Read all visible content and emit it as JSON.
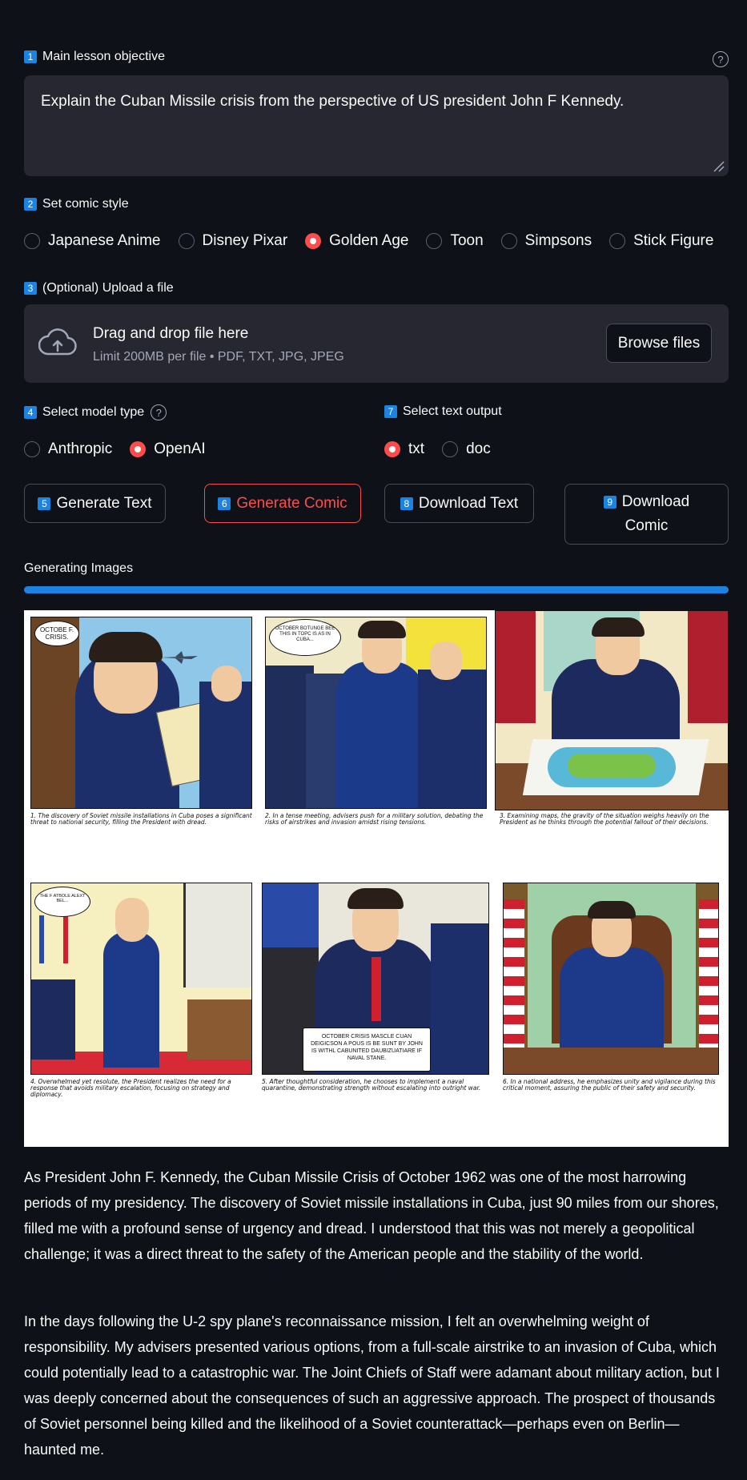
{
  "objective": {
    "badge": "1",
    "label": "Main lesson objective",
    "help_icon": "?",
    "value": "Explain the Cuban Missile crisis from the perspective of US president John F Kennedy."
  },
  "style": {
    "badge": "2",
    "label": "Set comic style",
    "options": [
      "Japanese Anime",
      "Disney Pixar",
      "Golden Age",
      "Toon",
      "Simpsons",
      "Stick Figure"
    ],
    "selected": "Golden Age"
  },
  "upload": {
    "badge": "3",
    "label": "(Optional) Upload a file",
    "drop_title": "Drag and drop file here",
    "drop_subtitle": "Limit 200MB per file • PDF, TXT, JPG, JPEG",
    "browse_label": "Browse files",
    "icon": "cloud-upload-icon"
  },
  "model": {
    "badge": "4",
    "label": "Select model type",
    "help_icon": "?",
    "options": [
      "Anthropic",
      "OpenAI"
    ],
    "selected": "OpenAI"
  },
  "text_output": {
    "badge": "7",
    "label": "Select text output",
    "options": [
      "txt",
      "doc"
    ],
    "selected": "txt"
  },
  "buttons": {
    "generate_text_badge": "5",
    "generate_text": "Generate Text",
    "generate_comic_badge": "6",
    "generate_comic": "Generate Comic",
    "download_text_badge": "8",
    "download_text": "Download Text",
    "download_comic_badge": "9",
    "download_comic_line1": "Download",
    "download_comic_line2": "Comic"
  },
  "status": {
    "label": "Generating Images",
    "progress": 1.0
  },
  "comic": {
    "panels": [
      {
        "bubble": "OCTOBE F. CRISIS.",
        "caption": "1. The discovery of Soviet missile installations in Cuba poses a significant threat to national security, filling the President with dread."
      },
      {
        "bubble": "OCTOBER BOTUNGE BEE THIS IN TOPC IS AS IN CUBA...",
        "caption": "2. In a tense meeting, advisers push for a military solution, debating the risks of airstrikes and invasion amidst rising tensions."
      },
      {
        "bubble": "",
        "caption": "3. Examining maps, the gravity of the situation weighs heavily on the President as he thinks through the potential fallout of their decisions."
      },
      {
        "bubble": "THE F ATBOLE ALEXT BEL...",
        "caption": "4. Overwhelmed yet resolute, the President realizes the need for a response that avoids military escalation, focusing on strategy and diplomacy."
      },
      {
        "bubble": "OCTOBER CRISIS MASCLE CUAN DEIGICSON A POUS IS BE SUNT BY JOHN IS WITHL CABUNITED DAUBIZUATIARE IF NAVAL STANE.",
        "caption": "5. After thoughtful consideration, he chooses to implement a naval quarantine, demonstrating strength without escalating into outright war."
      },
      {
        "bubble": "",
        "caption": "6. In a national address, he emphasizes unity and vigilance during this critical moment, assuring the public of their safety and security."
      }
    ]
  },
  "output_text": {
    "paragraphs": [
      "As President John F. Kennedy, the Cuban Missile Crisis of October 1962 was one of the most harrowing periods of my presidency. The discovery of Soviet missile installations in Cuba, just 90 miles from our shores, filled me with a profound sense of urgency and dread. I understood that this was not merely a geopolitical challenge; it was a direct threat to the safety of the American people and the stability of the world.",
      "In the days following the U-2 spy plane's reconnaissance mission, I felt an overwhelming weight of responsibility. My advisers presented various options, from a full-scale airstrike to an invasion of Cuba, which could potentially lead to a catastrophic war. The Joint Chiefs of Staff were adamant about military action, but I was deeply concerned about the consequences of such an aggressive approach. The prospect of thousands of Soviet personnel being killed and the likelihood of a Soviet counterattack—perhaps even on Berlin—haunted me."
    ]
  },
  "colors": {
    "background": "#0e1117",
    "accent": "#ff4b4b",
    "badge": "#1c83e1",
    "progress": "#1c83e1"
  }
}
